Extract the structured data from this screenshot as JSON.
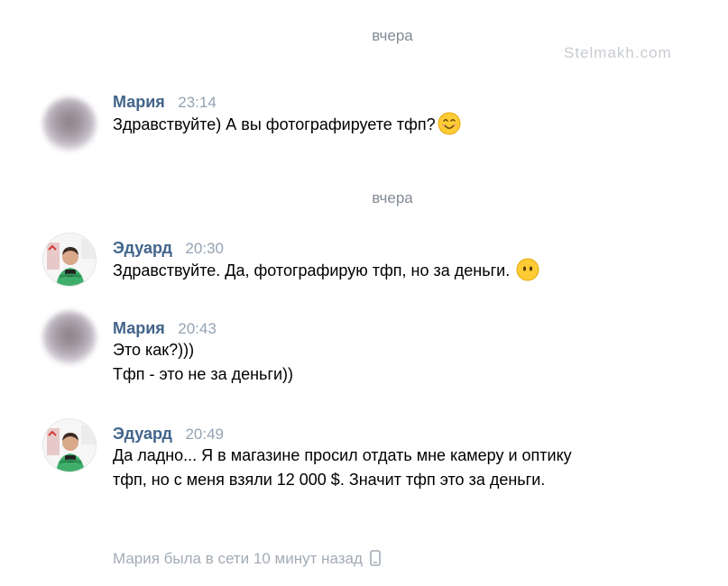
{
  "watermark": "Stelmakh.com",
  "date_separators": [
    "вчера",
    "вчера"
  ],
  "messages": [
    {
      "author": "Мария",
      "time": "23:14",
      "lines": [
        "Здравствуйте) А вы фотографируете тфп?"
      ],
      "emoji": "smiling-face-icon"
    },
    {
      "author": "Эдуард",
      "time": "20:30",
      "lines": [
        "Здравствуйте. Да, фотографирую тфп, но за деньги. "
      ],
      "emoji": "face-without-mouth-icon"
    },
    {
      "author": "Мария",
      "time": "20:43",
      "lines": [
        "Это как?)))",
        "Тфп - это не за деньги))"
      ]
    },
    {
      "author": "Эдуард",
      "time": "20:49",
      "lines": [
        "Да ладно... Я в магазине просил отдать мне камеру и оптику",
        "тфп, но с меня взяли 12 000 $. Значит тфп это за деньги."
      ]
    }
  ],
  "status": {
    "text": "Мария была в сети 10 минут назад",
    "icon": "mobile-phone-icon"
  },
  "colors": {
    "author": "#42648b",
    "time": "#93a3b3",
    "date_separator": "#838b95",
    "status": "#a3abb5",
    "emoji_yellow": "#ffcc33"
  }
}
